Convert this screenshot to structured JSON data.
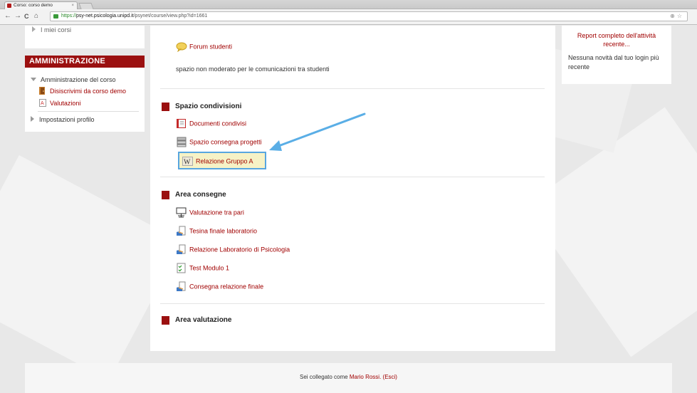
{
  "browser": {
    "tab_title": "Corso: corso demo",
    "tab_close": "×",
    "url_scheme": "https://",
    "url_host": "psy-net.psicologia.unipd.it",
    "url_path": "/psynet/course/view.php?id=1661",
    "back": "←",
    "forward": "→",
    "reload": "C",
    "home": "⌂",
    "address_icons": "⊕☆"
  },
  "left": {
    "my_courses": "I miei corsi",
    "admin_title": "AMMINISTRAZIONE",
    "course_admin": "Amministrazione del corso",
    "unenroll": "Disiscrivimi da corso demo",
    "grades": "Valutazioni",
    "profile_settings": "Impostazioni profilo"
  },
  "main": {
    "forum_label": "Forum studenti",
    "forum_desc": "spazio non moderato per le comunicazioni tra studenti",
    "section1_title": "Spazio condivisioni",
    "shared_docs": "Documenti condivisi",
    "project_space": "Spazio consegna progetti",
    "wiki_group": "Relazione Gruppo A",
    "section2_title": "Area consegne",
    "peer_review": "Valutazione tra pari",
    "final_thesis": "Tesina finale laboratorio",
    "lab_report": "Relazione Laboratorio di Psicologia",
    "test_module": "Test Modulo 1",
    "final_report": "Consegna relazione finale",
    "section3_title": "Area valutazione"
  },
  "right": {
    "report_link": "Report completo dell'attività recente...",
    "no_news": "Nessuna novità dal tuo login più recente"
  },
  "footer": {
    "logged_as": "Sei collegato come",
    "user": "Mario Rossi.",
    "logout": "(Esci)"
  },
  "colors": {
    "brand_red": "#9b1010",
    "link_red": "#a00000",
    "highlight_blue": "#58a6e0",
    "arrow_blue": "#5aaee6"
  }
}
